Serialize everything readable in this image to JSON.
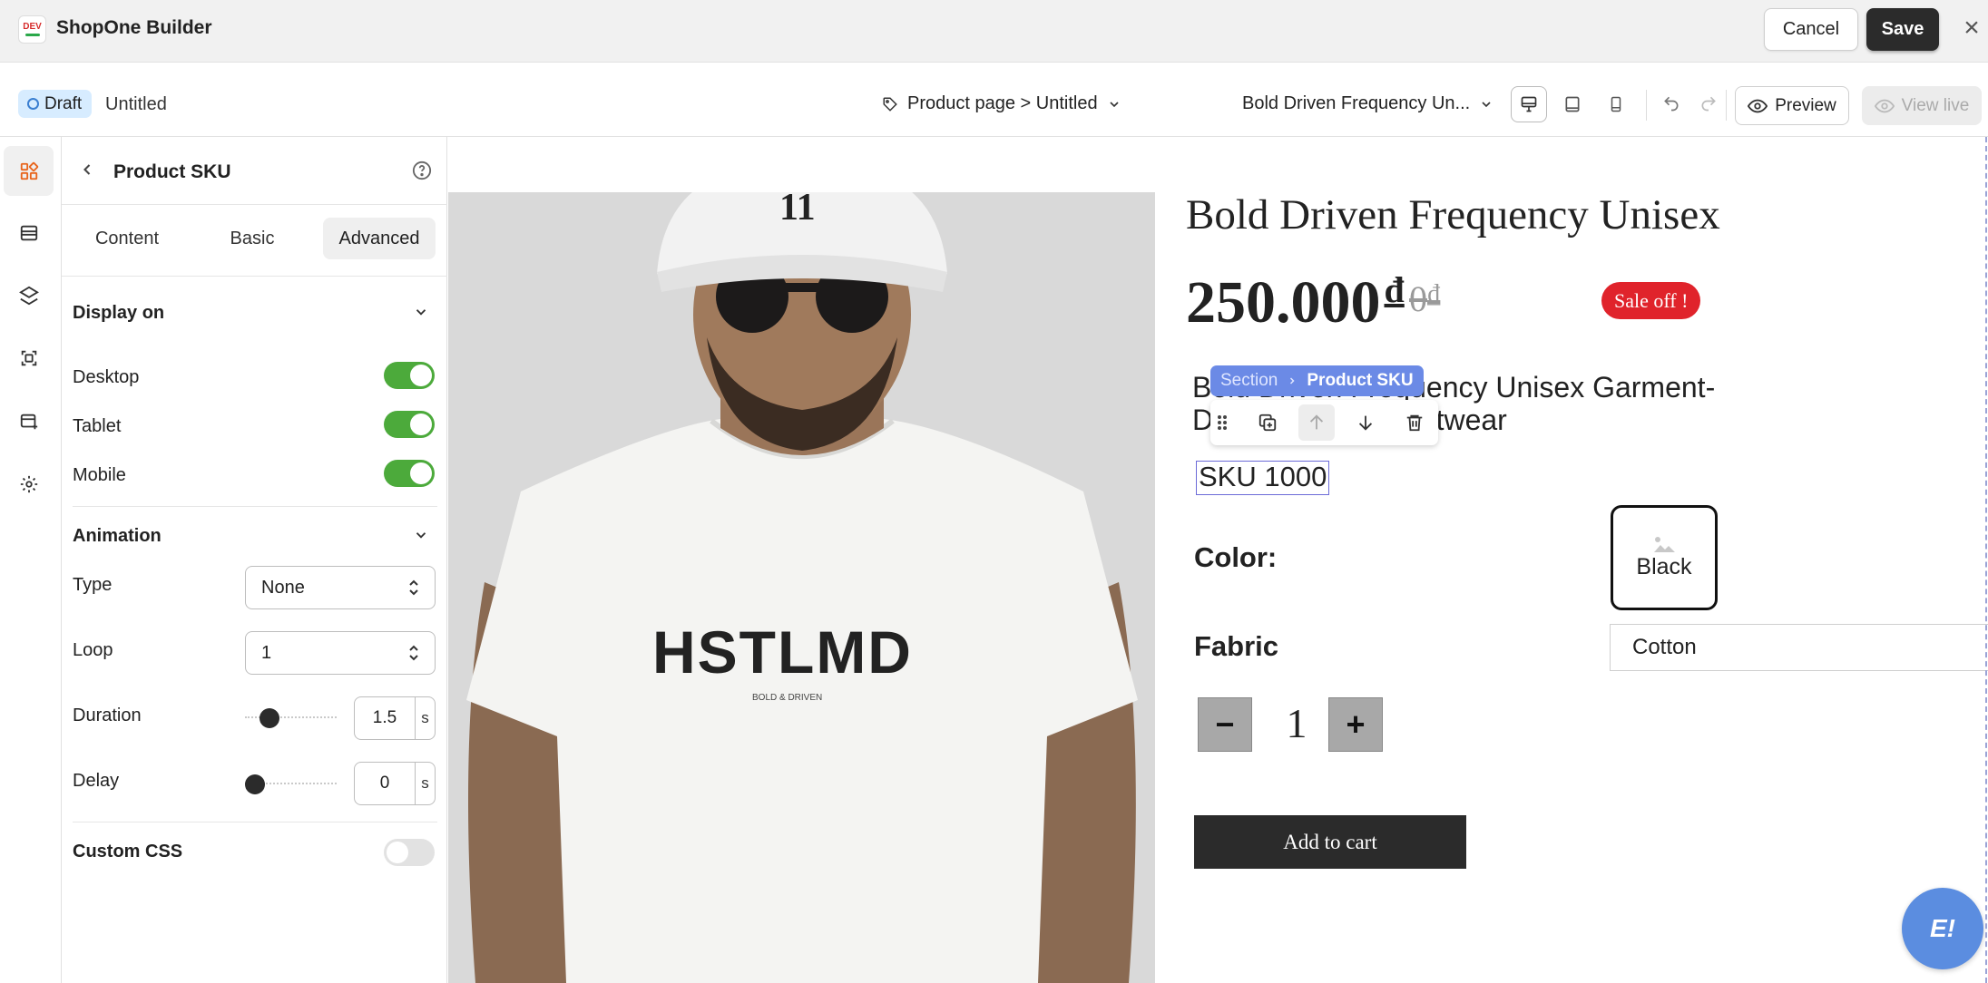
{
  "topbar": {
    "logo_text": "DEV",
    "title": "ShopOne Builder",
    "cancel_label": "Cancel",
    "save_label": "Save"
  },
  "subbar": {
    "status_badge": "Draft",
    "page_name": "Untitled",
    "page_selector": "Product page > Untitled",
    "product_selector": "Bold Driven Frequency Un...",
    "preview_label": "Preview",
    "view_live_label": "View live"
  },
  "panel": {
    "title": "Product SKU",
    "tabs": [
      "Content",
      "Basic",
      "Advanced"
    ],
    "active_tab": "Advanced",
    "display_on": {
      "title": "Display on",
      "rows": [
        {
          "label": "Desktop",
          "on": true
        },
        {
          "label": "Tablet",
          "on": true
        },
        {
          "label": "Mobile",
          "on": true
        }
      ]
    },
    "animation": {
      "title": "Animation",
      "type_label": "Type",
      "type_value": "None",
      "loop_label": "Loop",
      "loop_value": "1",
      "duration_label": "Duration",
      "duration_value": "1.5",
      "duration_unit": "s",
      "duration_level": 0.2,
      "delay_label": "Delay",
      "delay_value": "0",
      "delay_unit": "s",
      "delay_level": 0
    },
    "custom_css": {
      "label": "Custom CSS",
      "on": false
    }
  },
  "canvas": {
    "product_title": "Bold Driven Frequency Unisex",
    "price": "250.000",
    "price_currency": "đ",
    "compare_price": "0",
    "compare_currency": "₫",
    "sale_badge": "Sale off !",
    "description": "Bold Driven Frequency Unisex Garment-Dyed Casual Streetwear",
    "breadcrumb": {
      "parent": "Section",
      "current": "Product SKU"
    },
    "sku": "SKU 1000",
    "color_label": "Color:",
    "color_option": "Black",
    "fabric_label": "Fabric",
    "fabric_value": "Cotton",
    "quantity": "1",
    "qty_minus": "−",
    "qty_plus": "+",
    "add_to_cart": "Add to cart",
    "shirt_print": "HSTLMD",
    "shirt_subprint": "BOLD & DRIVEN",
    "chat_label": "E!"
  },
  "colors": {
    "accent_green": "#4caa3b",
    "sale_red": "#e0232b",
    "selection_blue": "#6b8ae6",
    "dark_button": "#2b2b2b"
  }
}
